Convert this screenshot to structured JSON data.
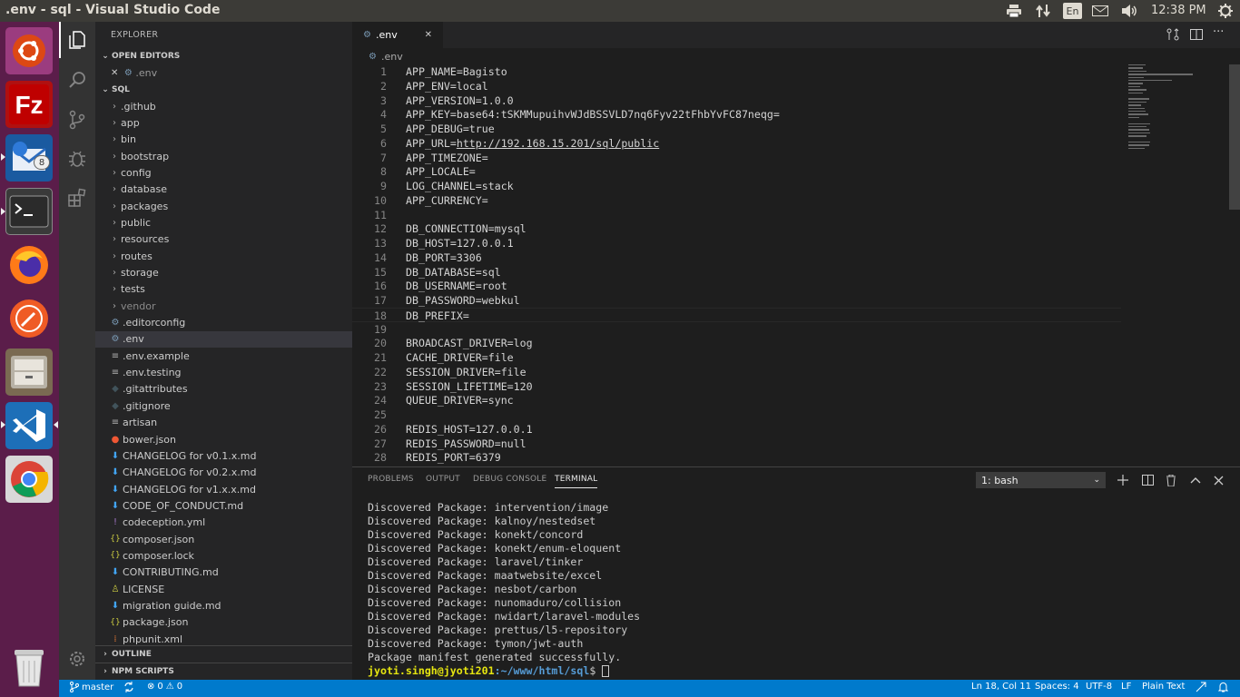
{
  "window": {
    "title": ".env - sql - Visual Studio Code"
  },
  "topbar": {
    "lang": "En",
    "clock": "12:38 PM",
    "icons": [
      "printer-icon",
      "transfer-icon",
      "mail-icon",
      "volume-icon",
      "power-gear-icon"
    ]
  },
  "launcher": {
    "apps": [
      "ubuntu-software",
      "filezilla",
      "thunderbird",
      "terminal",
      "firefox",
      "postman",
      "file-manager",
      "vscode",
      "chrome",
      "trash"
    ],
    "badge": "8"
  },
  "activity": {
    "items": [
      "explorer",
      "search",
      "source-control",
      "debug",
      "extensions",
      "settings"
    ]
  },
  "sidebar": {
    "title": "EXPLORER",
    "open_editors_label": "OPEN EDITORS",
    "open_editor_file": ".env",
    "folder_label": "SQL",
    "tree": [
      {
        "name": ".github",
        "type": "folder"
      },
      {
        "name": "app",
        "type": "folder"
      },
      {
        "name": "bin",
        "type": "folder"
      },
      {
        "name": "bootstrap",
        "type": "folder"
      },
      {
        "name": "config",
        "type": "folder"
      },
      {
        "name": "database",
        "type": "folder"
      },
      {
        "name": "packages",
        "type": "folder"
      },
      {
        "name": "public",
        "type": "folder"
      },
      {
        "name": "resources",
        "type": "folder"
      },
      {
        "name": "routes",
        "type": "folder"
      },
      {
        "name": "storage",
        "type": "folder"
      },
      {
        "name": "tests",
        "type": "folder"
      },
      {
        "name": "vendor",
        "type": "folder"
      },
      {
        "name": ".editorconfig",
        "type": "gear"
      },
      {
        "name": ".env",
        "type": "gear"
      },
      {
        "name": ".env.example",
        "type": "lines"
      },
      {
        "name": ".env.testing",
        "type": "lines"
      },
      {
        "name": ".gitattributes",
        "type": "git"
      },
      {
        "name": ".gitignore",
        "type": "git"
      },
      {
        "name": "artisan",
        "type": "lines"
      },
      {
        "name": "bower.json",
        "type": "bower"
      },
      {
        "name": "CHANGELOG for v0.1.x.md",
        "type": "md"
      },
      {
        "name": "CHANGELOG for v0.2.x.md",
        "type": "md"
      },
      {
        "name": "CHANGELOG for v1.x.x.md",
        "type": "md"
      },
      {
        "name": "CODE_OF_CONDUCT.md",
        "type": "md"
      },
      {
        "name": "codeception.yml",
        "type": "yml"
      },
      {
        "name": "composer.json",
        "type": "json"
      },
      {
        "name": "composer.lock",
        "type": "json"
      },
      {
        "name": "CONTRIBUTING.md",
        "type": "md"
      },
      {
        "name": "LICENSE",
        "type": "license"
      },
      {
        "name": "migration guide.md",
        "type": "md"
      },
      {
        "name": "package.json",
        "type": "json"
      },
      {
        "name": "phpunit.xml",
        "type": "xml"
      }
    ],
    "outline_label": "OUTLINE",
    "npm_label": "NPM SCRIPTS"
  },
  "editor": {
    "tab_label": ".env",
    "breadcrumb": ".env",
    "lines": [
      "APP_NAME=Bagisto",
      "APP_ENV=local",
      "APP_VERSION=1.0.0",
      "APP_KEY=base64:tSKMMupuihvWJdBSSVLD7nq6Fyv22tFhbYvFC87neqg=",
      "APP_DEBUG=true",
      "APP_URL=http://192.168.15.201/sql/public",
      "APP_TIMEZONE=",
      "APP_LOCALE=",
      "LOG_CHANNEL=stack",
      "APP_CURRENCY=",
      "",
      "DB_CONNECTION=mysql",
      "DB_HOST=127.0.0.1",
      "DB_PORT=3306",
      "DB_DATABASE=sql",
      "DB_USERNAME=root",
      "DB_PASSWORD=webkul",
      "DB_PREFIX=",
      "",
      "BROADCAST_DRIVER=log",
      "CACHE_DRIVER=file",
      "SESSION_DRIVER=file",
      "SESSION_LIFETIME=120",
      "QUEUE_DRIVER=sync",
      "",
      "REDIS_HOST=127.0.0.1",
      "REDIS_PASSWORD=null",
      "REDIS_PORT=6379"
    ],
    "url_prefix": "APP_URL=",
    "url_text": "http://192.168.15.201/sql/public",
    "current_line": 18
  },
  "panel": {
    "tabs": [
      "PROBLEMS",
      "OUTPUT",
      "DEBUG CONSOLE",
      "TERMINAL"
    ],
    "active_tab": "TERMINAL",
    "terminal_select": "1: bash",
    "terminal_lines": [
      "Discovered Package: intervention/image",
      "Discovered Package: kalnoy/nestedset",
      "Discovered Package: konekt/concord",
      "Discovered Package: konekt/enum-eloquent",
      "Discovered Package: laravel/tinker",
      "Discovered Package: maatwebsite/excel",
      "Discovered Package: nesbot/carbon",
      "Discovered Package: nunomaduro/collision",
      "Discovered Package: nwidart/laravel-modules",
      "Discovered Package: prettus/l5-repository",
      "Discovered Package: tymon/jwt-auth",
      "Package manifest generated successfully."
    ],
    "prompt_user": "jyoti.singh@jyoti201",
    "prompt_path": ":~/www/html/sql",
    "prompt_symbol": "$"
  },
  "statusbar": {
    "branch": "master",
    "errors": "0",
    "warnings": "0",
    "position": "Ln 18, Col 11",
    "spaces": "Spaces: 4",
    "encoding": "UTF-8",
    "eol": "LF",
    "language": "Plain Text"
  },
  "colors": {
    "accent": "#007acc",
    "launcher": "#5b1d4a",
    "prompt": "#569cd6",
    "terminal_user": "#e5e510"
  }
}
